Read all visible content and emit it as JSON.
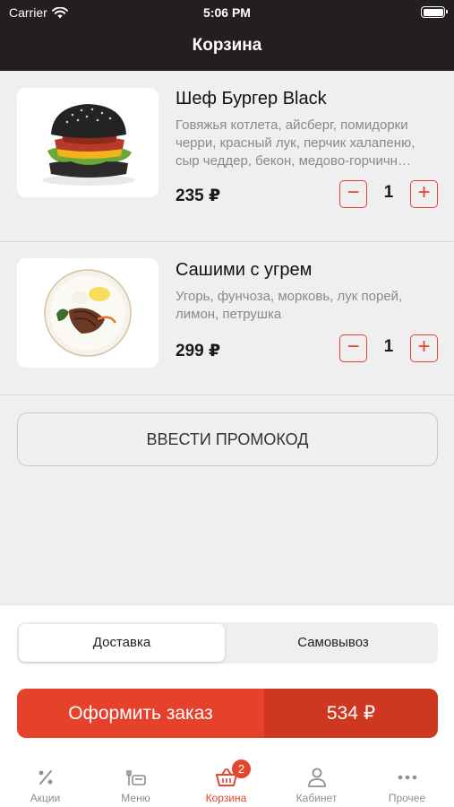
{
  "status_bar": {
    "carrier": "Carrier",
    "time": "5:06 PM"
  },
  "header": {
    "title": "Корзина"
  },
  "cart": {
    "items": [
      {
        "name": "Шеф Бургер Black",
        "description": "Говяжья котлета, айсберг, помидорки черри, красный лук, перчик халапеню, сыр чеддер, бекон, медово-горчичн…",
        "price": "235 ₽",
        "quantity": "1"
      },
      {
        "name": "Сашими с угрем",
        "description": "Угорь, фунчоза, морковь, лук порей, лимон, петрушка",
        "price": "299 ₽",
        "quantity": "1"
      }
    ],
    "minus_symbol": "−",
    "plus_symbol": "+"
  },
  "promo": {
    "label": "ВВЕСТИ ПРОМОКОД"
  },
  "delivery": {
    "options": [
      "Доставка",
      "Самовывоз"
    ],
    "selected": "Доставка"
  },
  "order": {
    "label": "Оформить заказ",
    "total": "534 ₽"
  },
  "tabbar": {
    "tabs": [
      {
        "label": "Акции",
        "icon": "percent-icon"
      },
      {
        "label": "Меню",
        "icon": "menu-icon"
      },
      {
        "label": "Корзина",
        "icon": "basket-icon",
        "badge": "2",
        "active": true
      },
      {
        "label": "Кабинет",
        "icon": "user-icon"
      },
      {
        "label": "Прочее",
        "icon": "more-icon"
      }
    ]
  },
  "colors": {
    "accent": "#e5442d",
    "header_bg": "#231f20",
    "background": "#efeff1"
  }
}
